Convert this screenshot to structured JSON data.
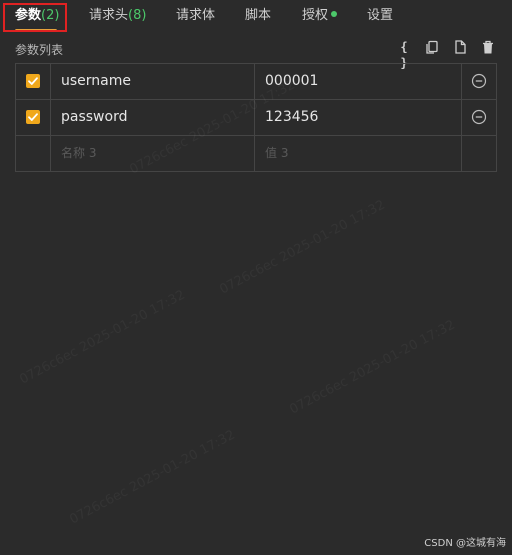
{
  "tabs": [
    {
      "label": "参数",
      "count": "(2)",
      "active": true
    },
    {
      "label": "请求头",
      "count": "(8)",
      "active": false
    },
    {
      "label": "请求体",
      "count": "",
      "active": false
    },
    {
      "label": "脚本",
      "count": "",
      "active": false
    },
    {
      "label": "授权",
      "count": "",
      "active": false
    },
    {
      "label": "设置",
      "count": "",
      "active": false
    }
  ],
  "section": {
    "title": "参数列表",
    "toolbar_icons": [
      "braces-icon",
      "copy-icon",
      "file-icon",
      "trash-icon"
    ],
    "braces_glyph": "{ }"
  },
  "params": {
    "rows": [
      {
        "checked": true,
        "name": "username",
        "value": "000001"
      },
      {
        "checked": true,
        "name": "password",
        "value": "123456"
      }
    ],
    "new_row": {
      "name_placeholder": "名称 3",
      "value_placeholder": "值 3"
    }
  },
  "watermark": {
    "entries": [
      "0726c6ec  2025-01-20 17:32",
      "0726c6ec  2025-01-20 17:32",
      "0726c6ec  2025-01-20 17:32",
      "0726c6ec  2025-01-20 17:32",
      "0726c6ec  2025-01-20 17:32"
    ]
  },
  "credit": "CSDN @这城有海",
  "colors": {
    "background": "#2b2b2b",
    "accent_orange": "#f0a81c",
    "count_green": "#4cc86a",
    "highlight_red": "#e02222"
  }
}
